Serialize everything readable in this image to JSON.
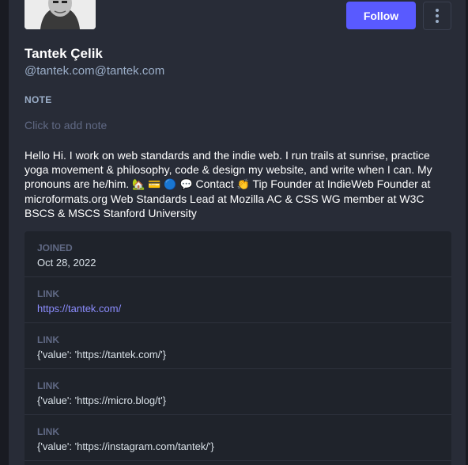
{
  "profile": {
    "display_name": "Tantek Çelik",
    "handle": "@tantek.com@tantek.com",
    "follow_label": "Follow",
    "note_label": "NOTE",
    "note_placeholder": "Click to add note",
    "bio": {
      "part1": "Hello Hi. I work on web standards and the indie web. I run trails at sunrise, practice yoga movement & philosophy, code & design my website, and write when I can. My pronouns are he/him. ",
      "emoji_house": "🏡",
      "emoji_card": "💳",
      "emoji_circle": "🔵",
      "emoji_speech": "💬",
      "part2": " Contact ",
      "emoji_clap": "👏",
      "part3": " Tip Founder at IndieWeb Founder at microformats.org Web Standards Lead at Mozilla AC & CSS WG member at W3C BSCS & MSCS Stanford University"
    }
  },
  "fields": [
    {
      "label": "JOINED",
      "value": "Oct 28, 2022"
    },
    {
      "label": "LINK",
      "value": "https://tantek.com/"
    },
    {
      "label": "LINK",
      "value": "{'value': 'https://tantek.com/'}"
    },
    {
      "label": "LINK",
      "value": "{'value': 'https://micro.blog/t'}"
    },
    {
      "label": "LINK",
      "value": "{'value': 'https://instagram.com/tantek/'}"
    }
  ],
  "colors": {
    "accent": "#595aff",
    "link": "#8c8dff",
    "panel": "#282c37",
    "fields_bg": "#1f232b"
  }
}
